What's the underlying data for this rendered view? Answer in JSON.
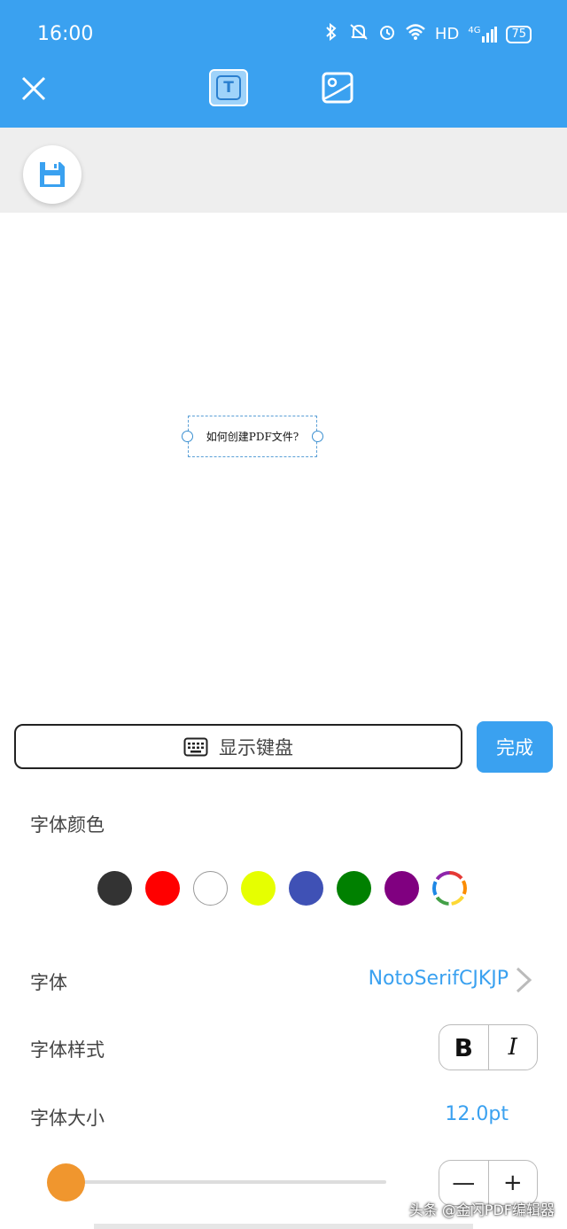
{
  "status_bar": {
    "time": "16:00",
    "network": "HD",
    "signal": "4G",
    "battery": "75"
  },
  "toolbar": {
    "text_tool_label": "T"
  },
  "canvas": {
    "text": "如何创建PDF文件?"
  },
  "keyboard_button": {
    "label": "显示键盘"
  },
  "done_button": {
    "label": "完成"
  },
  "font_color": {
    "label": "字体颜色",
    "colors": [
      "#333333",
      "#ff0000",
      "#ffffff",
      "#e6ff00",
      "#3f51b5",
      "#008000",
      "#800080",
      "custom"
    ]
  },
  "font": {
    "label": "字体",
    "value": "NotoSerifCJKJP"
  },
  "font_style": {
    "label": "字体样式",
    "bold": "B",
    "italic": "I"
  },
  "font_size": {
    "label": "字体大小",
    "value": "12.0pt",
    "slider_fraction": 0.05,
    "minus": "—",
    "plus": "+"
  },
  "watermark": "头条 @金闪PDF编辑器",
  "colors": {
    "accent": "#3aa1f0",
    "slider": "#f0962e"
  }
}
